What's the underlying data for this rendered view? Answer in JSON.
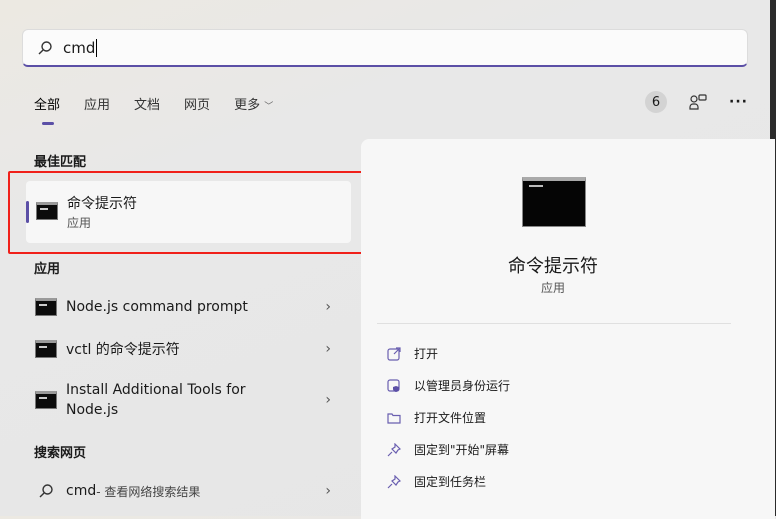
{
  "search": {
    "value": "cmd"
  },
  "tabs": [
    {
      "label": "全部"
    },
    {
      "label": "应用"
    },
    {
      "label": "文档"
    },
    {
      "label": "网页"
    },
    {
      "label": "更多"
    }
  ],
  "toolbar": {
    "badge": "6"
  },
  "best_match": {
    "header": "最佳匹配",
    "title": "命令提示符",
    "subtitle": "应用"
  },
  "apps": {
    "header": "应用",
    "items": [
      {
        "label": "Node.js command prompt"
      },
      {
        "label": "vctl 的命令提示符"
      },
      {
        "label": "Install Additional Tools for",
        "label2": "Node.js"
      }
    ]
  },
  "web": {
    "header": "搜索网页",
    "query": "cmd",
    "suffix": " - 查看网络搜索结果"
  },
  "preview": {
    "title": "命令提示符",
    "subtitle": "应用",
    "actions": [
      {
        "label": "打开",
        "icon": "open-external-icon"
      },
      {
        "label": "以管理员身份运行",
        "icon": "admin-shield-icon"
      },
      {
        "label": "打开文件位置",
        "icon": "folder-icon"
      },
      {
        "label": "固定到\"开始\"屏幕",
        "icon": "pin-icon"
      },
      {
        "label": "固定到任务栏",
        "icon": "pin-icon"
      }
    ]
  },
  "colors": {
    "accent": "#5b4fa6",
    "highlight_box": "#f0201a"
  }
}
